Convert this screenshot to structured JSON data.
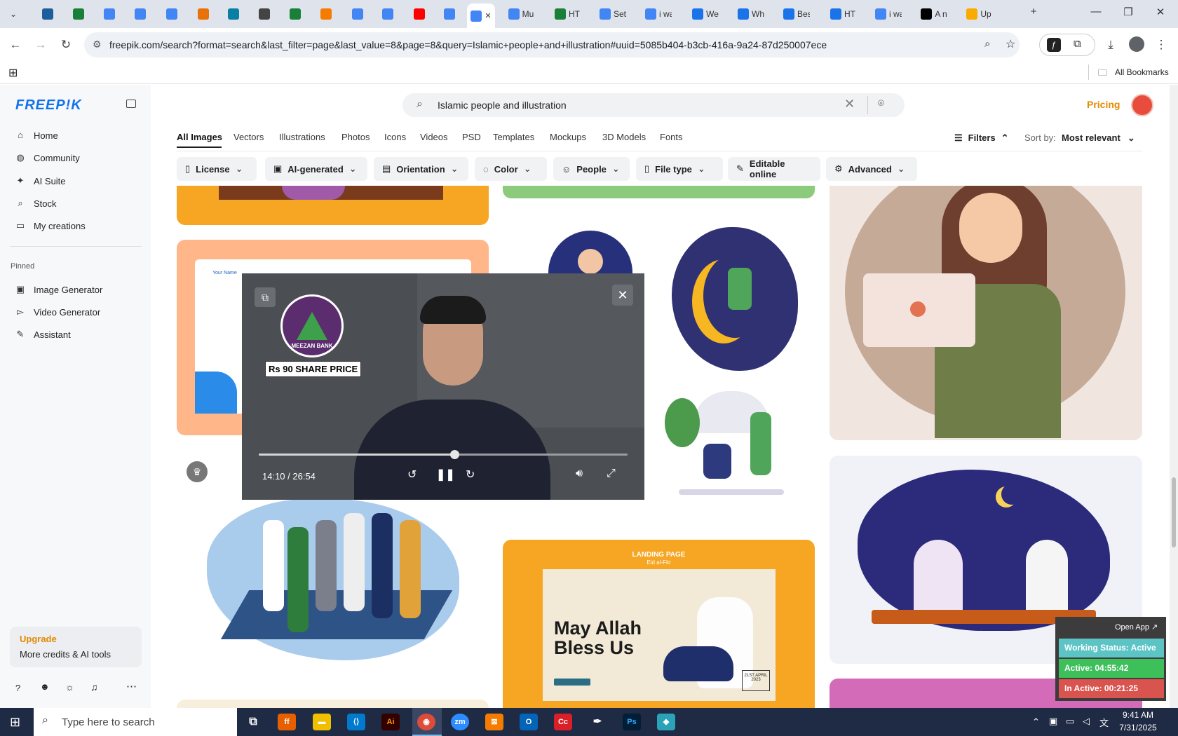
{
  "browser": {
    "tabs": [
      {
        "title": "",
        "color": "#1b5e9b"
      },
      {
        "title": "",
        "color": "#188038"
      },
      {
        "title": "",
        "color": "#4285f4"
      },
      {
        "title": "",
        "color": "#4285f4"
      },
      {
        "title": "",
        "color": "#4285f4"
      },
      {
        "title": "",
        "color": "#e8710a"
      },
      {
        "title": "",
        "color": "#0b7ea3"
      },
      {
        "title": "",
        "color": "#444"
      },
      {
        "title": "",
        "color": "#188038"
      },
      {
        "title": "",
        "color": "#f57c00"
      },
      {
        "title": "",
        "color": "#4285f4"
      },
      {
        "title": "",
        "color": "#4285f4"
      },
      {
        "title": "",
        "color": "#ff0000"
      },
      {
        "title": "",
        "color": "#4285f4"
      },
      {
        "title": "",
        "color": "#4285f4"
      },
      {
        "title": "Mu",
        "color": "#4285f4"
      },
      {
        "title": "HT",
        "color": "#188038"
      },
      {
        "title": "Set",
        "color": "#4285f4"
      },
      {
        "title": "i wa",
        "color": "#4285f4"
      },
      {
        "title": "We",
        "color": "#1a73e8"
      },
      {
        "title": "Wh",
        "color": "#1a73e8"
      },
      {
        "title": "Bes",
        "color": "#1a73e8"
      },
      {
        "title": "HT",
        "color": "#1a73e8"
      },
      {
        "title": "i wa",
        "color": "#4285f4"
      },
      {
        "title": "A n",
        "color": "#000"
      },
      {
        "title": "Up",
        "color": "#f9ab00"
      }
    ],
    "url": "freepik.com/search?format=search&last_filter=page&last_value=8&page=8&query=Islamic+people+and+illustration#uuid=5085b404-b3cb-416a-9a24-87d250007ece",
    "all_bookmarks": "All Bookmarks"
  },
  "freepik": {
    "logo": "FREEP!K",
    "search_value": "Islamic people and illustration",
    "pricing": "Pricing",
    "sidebar": {
      "items": [
        "Home",
        "Community",
        "AI Suite",
        "Stock",
        "My creations"
      ],
      "pinned_label": "Pinned",
      "pinned": [
        "Image Generator",
        "Video Generator",
        "Assistant"
      ],
      "upgrade_title": "Upgrade",
      "upgrade_sub": "More credits & AI tools"
    },
    "categories": [
      "All Images",
      "Vectors",
      "Illustrations",
      "Photos",
      "Icons",
      "Videos",
      "PSD",
      "Templates",
      "Mockups",
      "3D Models",
      "Fonts"
    ],
    "filters_label": "Filters",
    "sort_label": "Sort by:",
    "sort_value": "Most relevant",
    "chips": [
      "License",
      "AI-generated",
      "Orientation",
      "Color",
      "People",
      "File type",
      "Editable online",
      "Advanced"
    ]
  },
  "cards": {
    "landing_page": "LANDING PAGE",
    "landing_sub": "Eid al-Fitr",
    "headline": "May Allah Bless Us",
    "date": "21ST APRIL 2023",
    "your_name": "Your Name"
  },
  "video": {
    "overlay": "Rs 90 SHARE PRICE",
    "bank": "MEEZAN BANK",
    "time": "14:10 / 26:54",
    "progress": 0.53
  },
  "widget": {
    "open_app": "Open App ↗",
    "status": "Working Status: Active",
    "active": "Active: 04:55:42",
    "inactive": "In Active: 00:21:25"
  },
  "taskbar": {
    "search_placeholder": "Type here to search",
    "time": "9:41 AM",
    "date": "7/31/2025"
  }
}
